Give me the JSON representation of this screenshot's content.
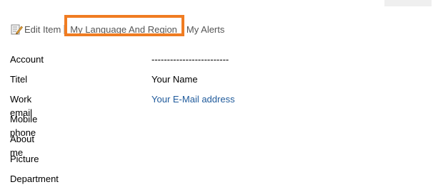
{
  "toolbar": {
    "edit_item": {
      "label": "Edit Item",
      "icon": "edit-icon"
    },
    "language_region": {
      "label": "My Language And Region"
    },
    "alerts": {
      "label": "My Alerts"
    },
    "highlight_color": "#f07c22"
  },
  "profile": {
    "rows": [
      {
        "label": "Account",
        "value": "-------------------------"
      },
      {
        "label": "Titel",
        "value": "Your Name"
      },
      {
        "label": "Work email",
        "value": "Your E-Mail address"
      },
      {
        "label": "Mobile phone",
        "value": ""
      },
      {
        "label": "About me",
        "value": ""
      },
      {
        "label": "Picture",
        "value": ""
      },
      {
        "label": "Department",
        "value": ""
      }
    ],
    "link_color": "#1f5a9b"
  }
}
